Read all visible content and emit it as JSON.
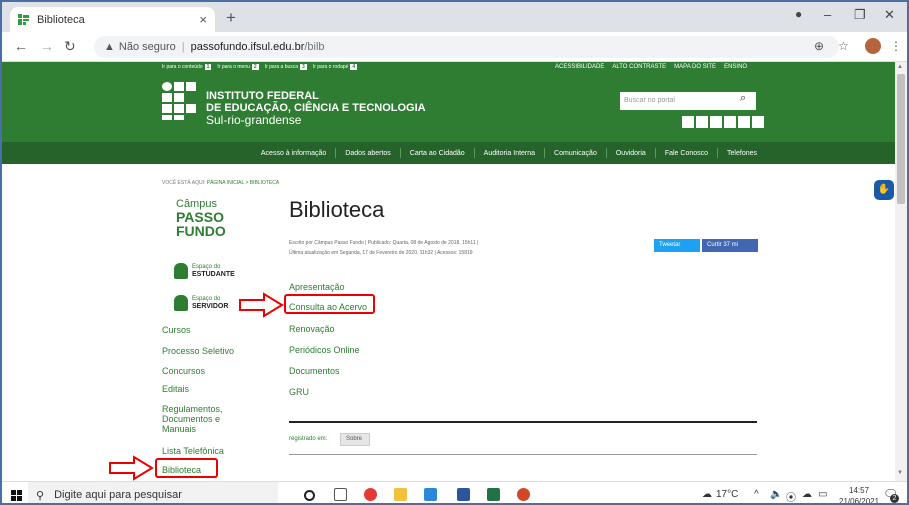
{
  "browser": {
    "tab_title": "Biblioteca",
    "tab_close": "×",
    "new_tab": "+",
    "warning": "▲",
    "not_secure": "Não seguro",
    "url_host": "passofundo.ifsul.edu.br",
    "url_path": "/bilb"
  },
  "header": {
    "access_links": [
      {
        "label": "Ir para o conteúdo",
        "key": "1"
      },
      {
        "label": "Ir para o menu",
        "key": "2"
      },
      {
        "label": "Ir para a busca",
        "key": "3"
      },
      {
        "label": "Ir para o rodapé",
        "key": "4"
      }
    ],
    "top_links": [
      "ACESSIBILIDADE",
      "ALTO CONTRASTE",
      "MAPA DO SITE",
      "ENSINO"
    ],
    "inst_line1": "INSTITUTO FEDERAL",
    "inst_line2": "DE EDUCAÇÃO, CIÊNCIA E TECNOLOGIA",
    "inst_line3": "Sul-rio-grandense",
    "search_placeholder": "Buscar no portal",
    "menu": [
      "Acesso à informação",
      "Dados abertos",
      "Carta ao Cidadão",
      "Auditoria Interna",
      "Comunicação",
      "Ouvidoria",
      "Fale Conosco",
      "Telefones"
    ]
  },
  "content": {
    "breadcrumb_prefix": "VOCÊ ESTÁ AQUI:",
    "breadcrumb_path": "PÁGINA INICIAL > BIBLIOTECA",
    "campus_word": "Câmpus",
    "campus_name1": "PASSO",
    "campus_name2": "FUNDO",
    "espaco_label": "Espaço do",
    "estudante": "ESTUDANTE",
    "servidor": "SERVIDOR",
    "sidebar": [
      "Cursos",
      "Processo Seletivo",
      "Concursos",
      "Editais",
      "Regulamentos, Documentos e Manuais",
      "Lista Telefônica",
      "Biblioteca"
    ],
    "title": "Biblioteca",
    "meta_line1": "Escrito por Câmpus Passo Fundo | Publicado: Quarta, 08 de Agosto de 2018, 15h11 |",
    "meta_line2": "Última atualização em Segunda, 17 de Fevereiro de 2020, 11h32 | Acessos: 15819",
    "tweet": "Tweetar",
    "curtir": "Curtir 37 mi",
    "links": [
      "Apresentação",
      "Consulta ao Acervo",
      "Renovação",
      "Periódicos Online",
      "Documentos",
      "GRU"
    ],
    "registrado": "registrado em:",
    "tag": "Sobre"
  },
  "taskbar": {
    "search_text": "Digite aqui para pesquisar",
    "temp": "17°C",
    "time": "14:57",
    "date": "21/06/2021",
    "notif_count": "2"
  },
  "colors": {
    "ifsul_green": "#2e7d32",
    "highlight": "#e00000"
  }
}
